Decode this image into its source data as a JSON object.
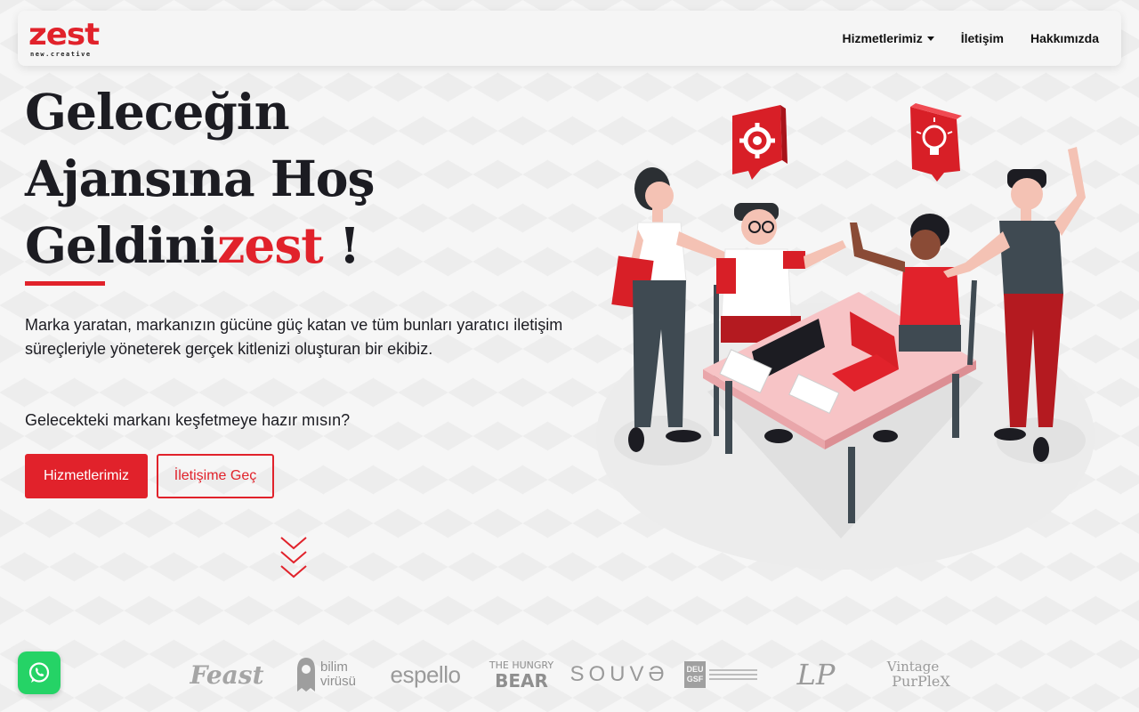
{
  "brand": {
    "name": "zest",
    "tagline": "new.creative",
    "accent_color": "#e1222b"
  },
  "nav": {
    "items": [
      {
        "label": "Hizmetlerimiz",
        "has_dropdown": true
      },
      {
        "label": "İletişim"
      },
      {
        "label": "Hakkımızda"
      }
    ]
  },
  "hero": {
    "title_line1": "Geleceğin",
    "title_line2": "Ajansına Hoş",
    "title_line3_prefix": "Geldini",
    "title_line3_accent": "zest",
    "title_line3_suffix": " !",
    "description": "Marka yaratan, markanızın gücüne güç katan ve tüm bunları yaratıcı iletişim süreçleriyle yöneterek gerçek kitlenizi oluşturan bir ekibiz.",
    "question": "Gelecekteki markanı keşfetmeye hazır mısın?",
    "primary_button": "Hizmetlerimiz",
    "secondary_button": "İletişime Geç"
  },
  "brands": [
    {
      "name": "Feast"
    },
    {
      "name": "bilim",
      "name2": "virüsü"
    },
    {
      "name": "espello"
    },
    {
      "name": "THE HUNGRY",
      "name2": "BEAR"
    },
    {
      "name": "SOUVƏ"
    },
    {
      "name": "DEU",
      "name2": "GSF"
    },
    {
      "name": "LP"
    },
    {
      "name": "Vintage",
      "name2": "PurPleX"
    }
  ],
  "icons": {
    "dropdown": "chevron-down-icon",
    "scroll": "scroll-down-icon",
    "whatsapp": "whatsapp-icon",
    "gear": "gear-icon",
    "lightbulb": "lightbulb-icon"
  }
}
